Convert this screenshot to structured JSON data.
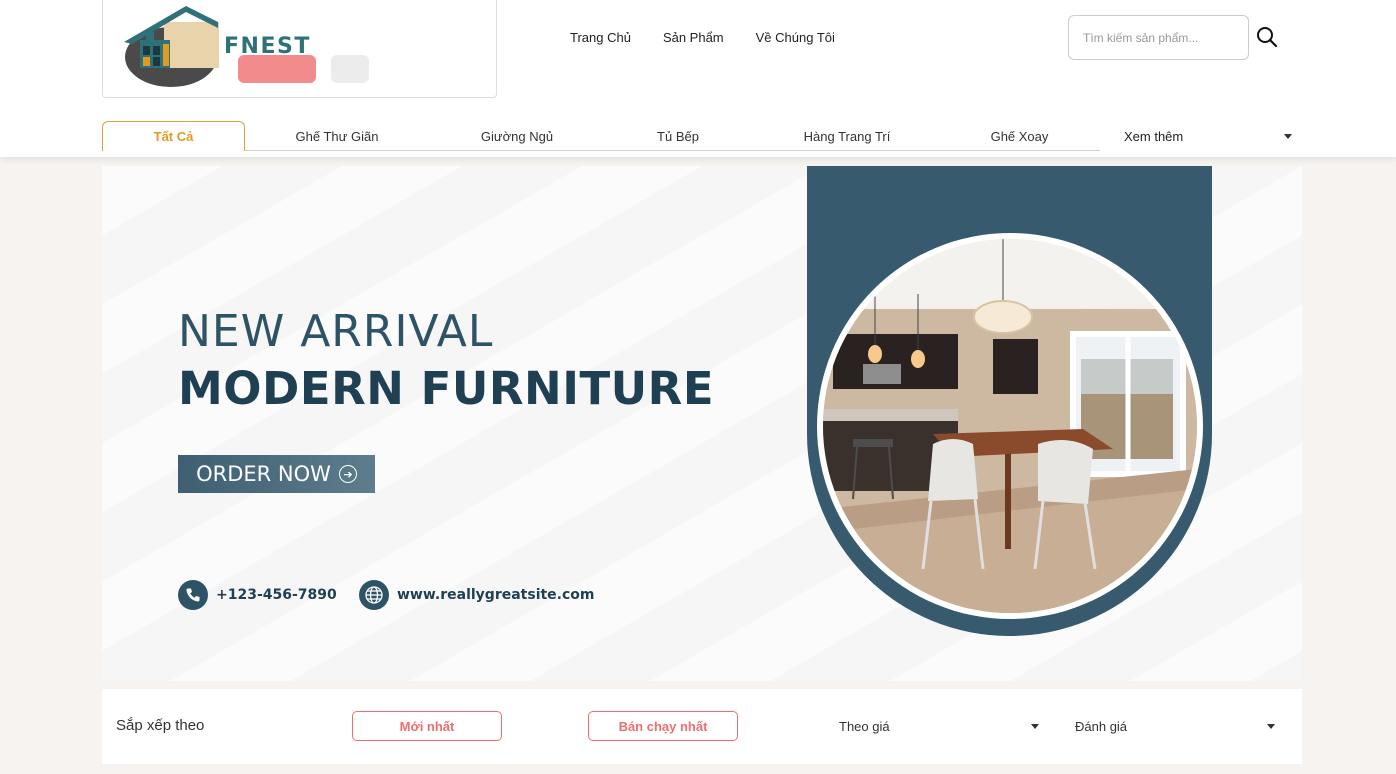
{
  "brand": {
    "name": "FNEST"
  },
  "nav": {
    "items": [
      "Trang Chủ",
      "Sản Phẩm",
      "Về Chúng Tôi"
    ]
  },
  "search": {
    "placeholder": "Tìm kiếm sản phẩm...",
    "icon": "search-icon"
  },
  "categories": {
    "active": "Tất Cả",
    "items": [
      "Ghế Thư Giãn",
      "Giường Ngủ",
      "Tủ Bếp",
      "Hàng Trang Trí",
      "Ghế Xoay"
    ],
    "more": "Xem thêm"
  },
  "banner": {
    "headline_1": "NEW ARRIVAL",
    "headline_2": "MODERN FURNITURE",
    "cta": "ORDER NOW",
    "phone": "+123-456-7890",
    "website": "www.reallygreatsite.com",
    "accent_color": "#375a6e"
  },
  "sort": {
    "label": "Sắp xếp theo",
    "newest": "Mới nhất",
    "best_selling": "Bán chạy nhất",
    "by_price": "Theo giá",
    "by_rating": "Đánh giá",
    "accent_color": "#ef6f6f"
  }
}
